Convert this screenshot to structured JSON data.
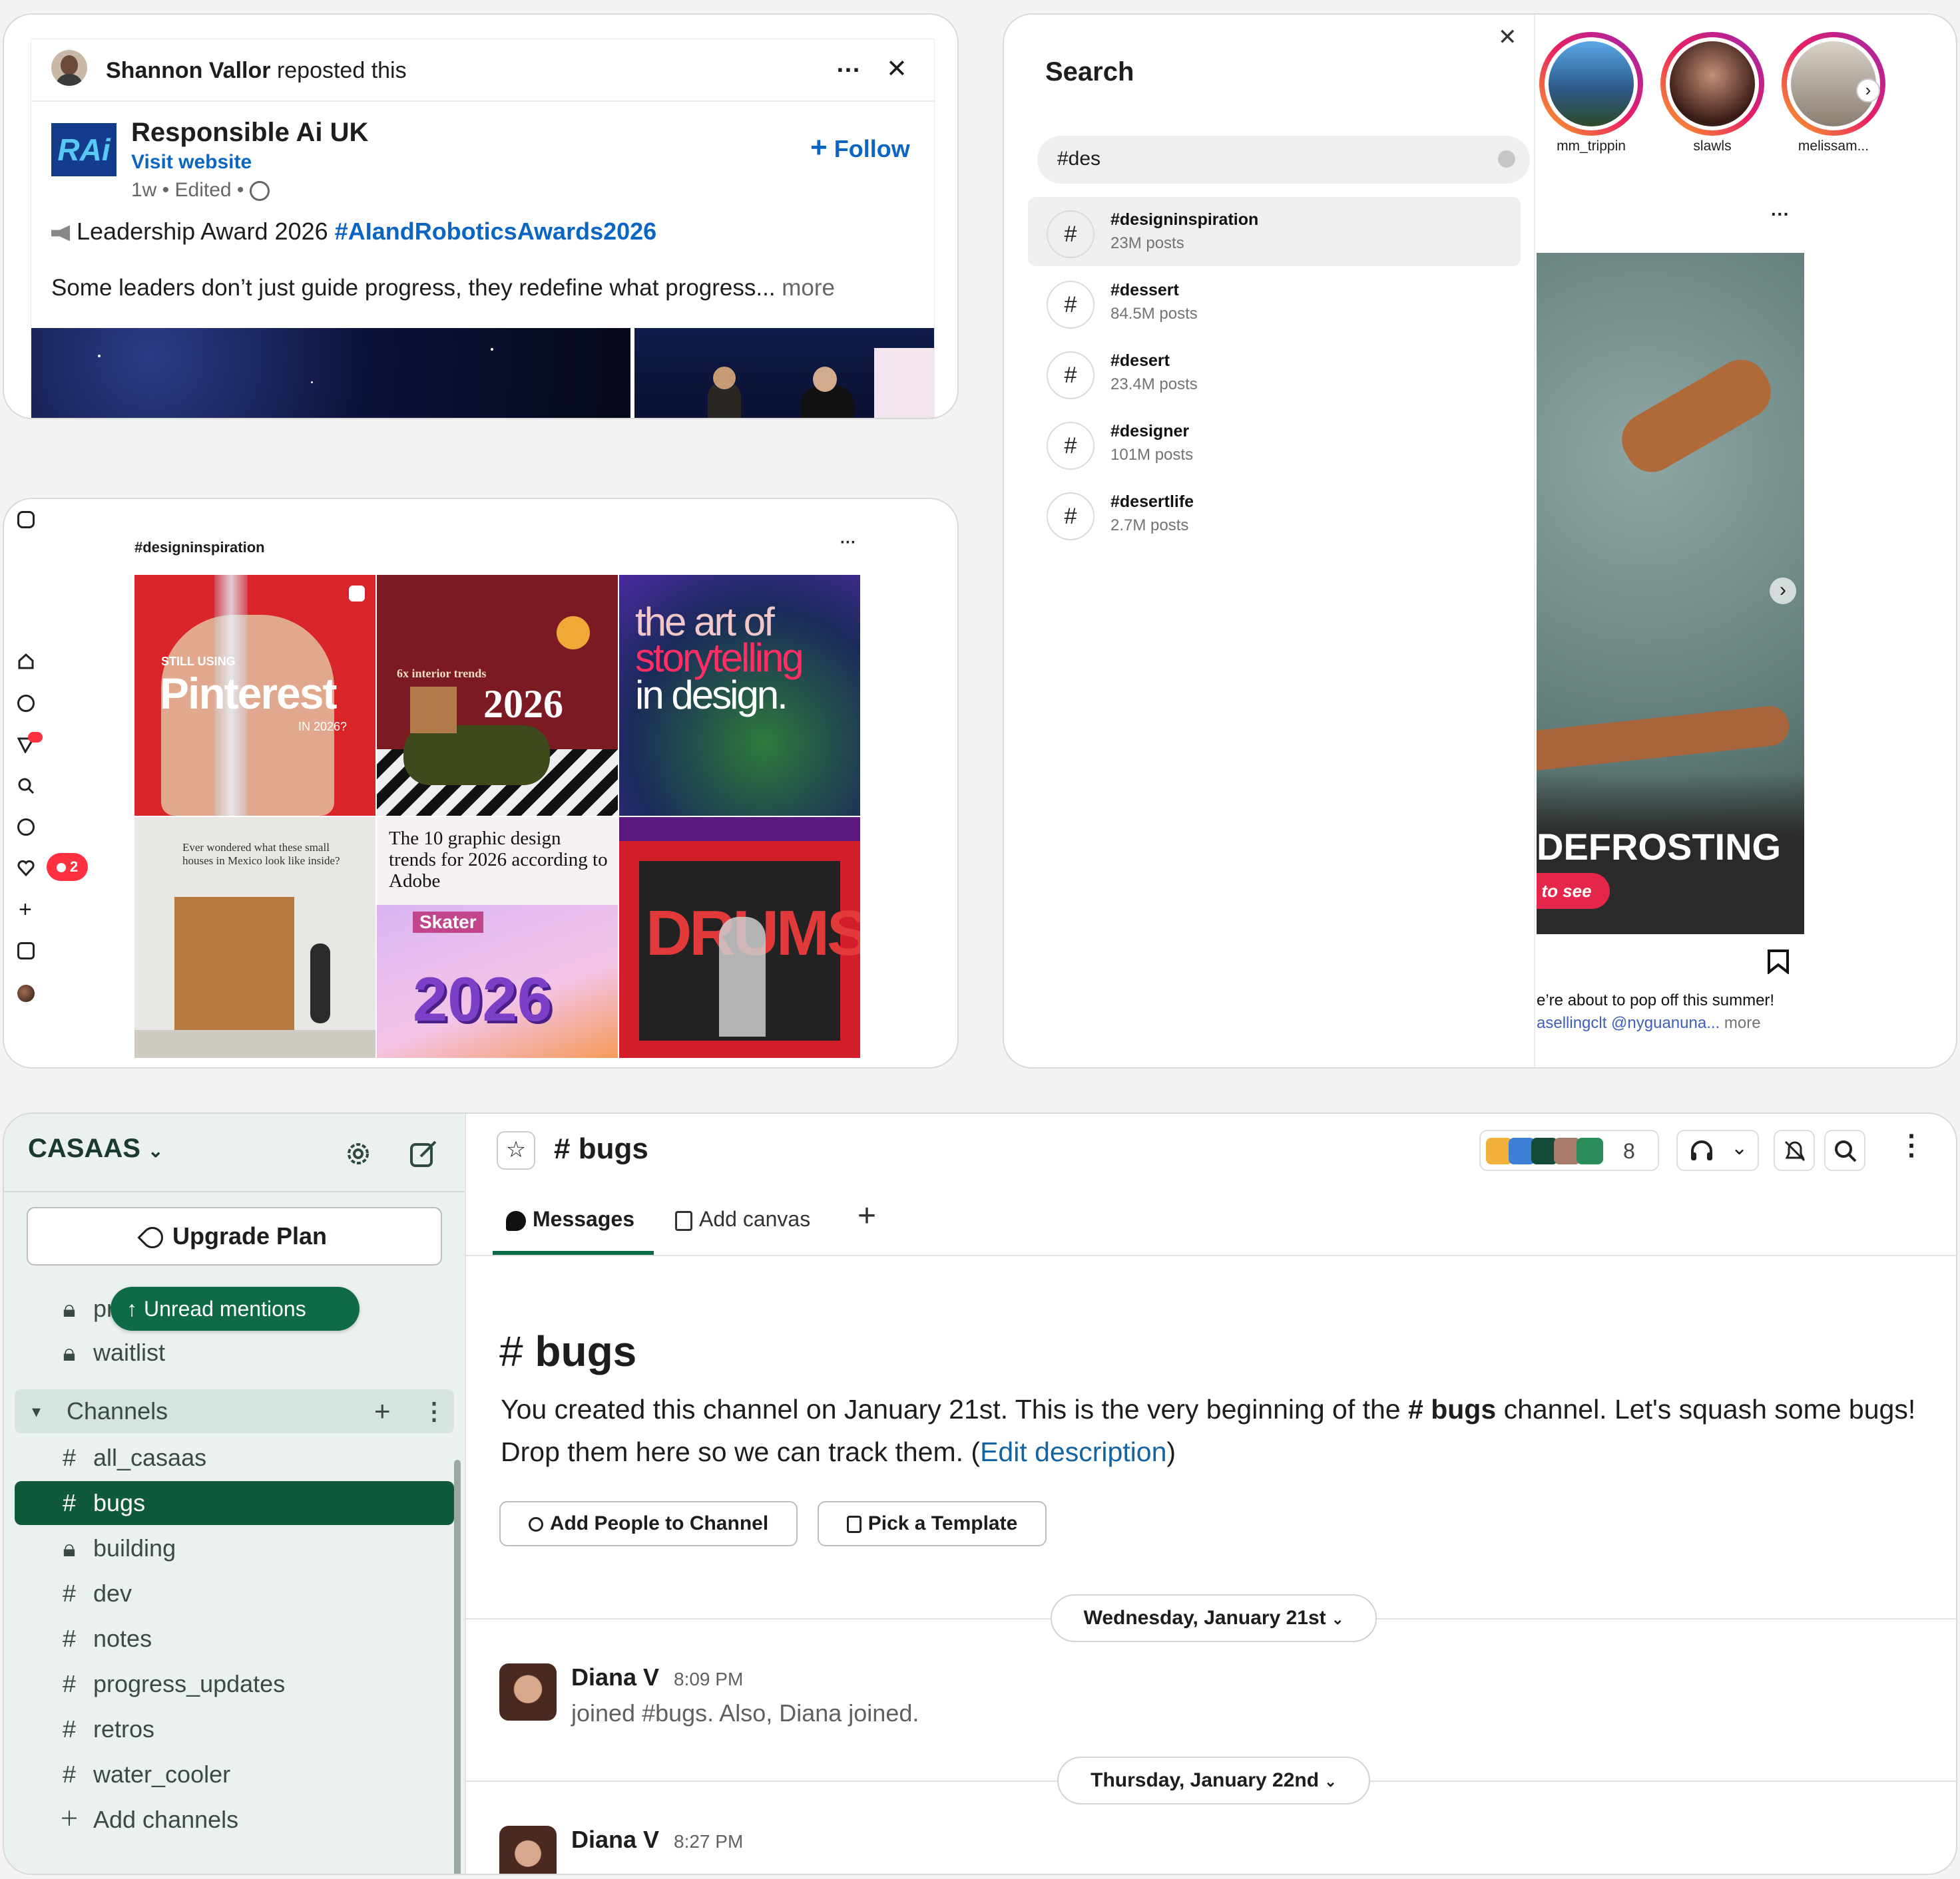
{
  "linkedin": {
    "reposter": "Shannon Vallor",
    "reposted_suffix": "reposted this",
    "more_icon": "…",
    "close_icon": "✕",
    "org_logo": "RAi",
    "org_name": "Responsible Ai UK",
    "visit_website": "Visit website",
    "follow_label": "Follow",
    "meta": "1w • Edited •",
    "award_prefix": "Leadership Award 2026",
    "award_hashtag": "#AIandRoboticsAwards2026",
    "body": "Some leaders don’t just guide progress, they redefine what progress...",
    "more_label": "more"
  },
  "instagram_grid": {
    "hashtag": "#designinspiration",
    "dots": "···",
    "notification_count": "2",
    "tiles": [
      {
        "kicker": "STILL USING",
        "title": "Pinterest",
        "sub": "IN 2026?"
      },
      {
        "kicker": "6x interior trends",
        "title": "2026"
      },
      {
        "line1": "the art of",
        "line2": "storytelling",
        "line3": "in design."
      },
      {
        "caption": "Ever wondered what these small houses in Mexico look like inside?"
      },
      {
        "caption": "The 10 graphic design trends for 2026 according to Adobe",
        "big": "2026",
        "sticker": "Skater"
      },
      {
        "caption": "DRUMSP"
      }
    ]
  },
  "search_panel": {
    "title": "Search",
    "close_icon": "✕",
    "query": "#des",
    "results": [
      {
        "tag": "#designinspiration",
        "count": "23M posts"
      },
      {
        "tag": "#dessert",
        "count": "84.5M posts"
      },
      {
        "tag": "#desert",
        "count": "23.4M posts"
      },
      {
        "tag": "#designer",
        "count": "101M posts"
      },
      {
        "tag": "#desertlife",
        "count": "2.7M posts"
      }
    ],
    "stories": [
      {
        "user": "mm_trippin"
      },
      {
        "user": "slawls"
      },
      {
        "user": "melissam..."
      }
    ],
    "post_dots": "···",
    "post_headline": "DEFROSTING",
    "post_cta": "to see",
    "caption_line1": "e’re about to pop off this summer!",
    "caption_links": "asellingclt @nyguanuna...",
    "caption_more": "more"
  },
  "slack": {
    "workspace": "CASAAS",
    "upgrade_label": "Upgrade Plan",
    "unread_label": "Unread mentions",
    "private_items": [
      "pr",
      "waitlist"
    ],
    "section_label": "Channels",
    "channels": [
      "all_casaas",
      "bugs",
      "building",
      "dev",
      "notes",
      "progress_updates",
      "retros",
      "water_cooler"
    ],
    "add_channels": "Add channels",
    "channel_title": "bugs",
    "member_count": "8",
    "tabs": {
      "messages": "Messages",
      "canvas": "Add canvas"
    },
    "intro_title": "bugs",
    "intro_text_1": "You created this channel on January 21st. This is the very beginning of the",
    "intro_channel": "# bugs",
    "intro_text_2": "channel. Let's squash some bugs! Drop them here so we can track them. (",
    "edit_description": "Edit description",
    "intro_close": ")",
    "add_people": "Add People to Channel",
    "pick_template": "Pick a Template",
    "date1": "Wednesday, January 21st",
    "date2": "Thursday, January 22nd",
    "messages": [
      {
        "author": "Diana V",
        "time": "8:09 PM",
        "text": "joined #bugs. Also, Diana joined."
      },
      {
        "author": "Diana V",
        "time": "8:27 PM",
        "text": ""
      }
    ]
  }
}
